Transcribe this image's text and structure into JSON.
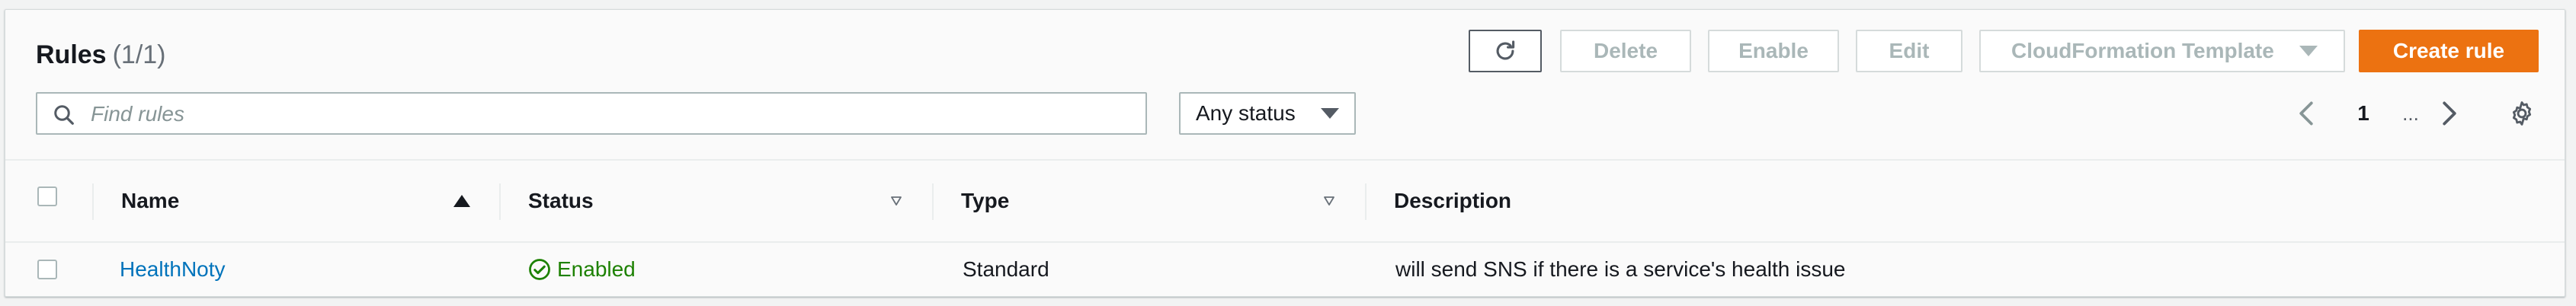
{
  "header": {
    "title": "Rules",
    "count": "(1/1)"
  },
  "toolbar": {
    "delete_label": "Delete",
    "enable_label": "Enable",
    "edit_label": "Edit",
    "cfn_label": "CloudFormation Template",
    "create_label": "Create rule"
  },
  "search": {
    "placeholder": "Find rules",
    "value": ""
  },
  "status_filter": {
    "selected": "Any status"
  },
  "pagination": {
    "current_page": "1",
    "ellipsis": "..."
  },
  "table": {
    "columns": [
      "Name",
      "Status",
      "Type",
      "Description"
    ],
    "rows": [
      {
        "name": "HealthNoty",
        "status": "Enabled",
        "type": "Standard",
        "description": "will send SNS if there is a service's health issue"
      }
    ]
  },
  "colors": {
    "primary_button": "#ec7211",
    "link": "#0073bb",
    "status_enabled": "#1d8102"
  },
  "icons": [
    "refresh-icon",
    "caret-down-icon",
    "search-icon",
    "chevron-left-icon",
    "chevron-right-icon",
    "gear-icon",
    "sort-ascending-icon",
    "sort-icon",
    "check-circle-icon"
  ]
}
